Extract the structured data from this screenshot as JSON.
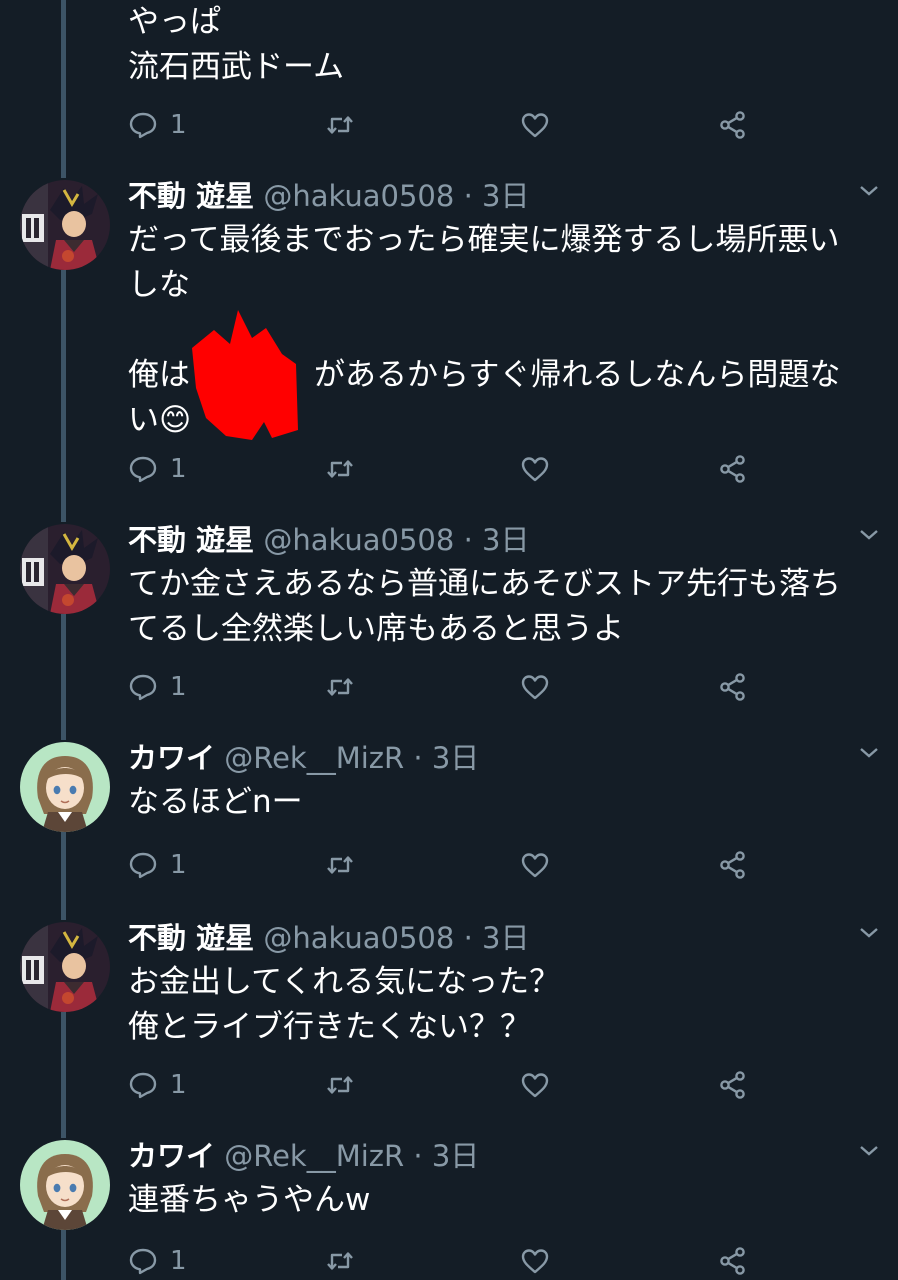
{
  "theme": {
    "background": "#141d26",
    "muted": "#8899a6",
    "thread_line": "#3d5466",
    "redaction": "#ff0000"
  },
  "tweets": [
    {
      "name": "",
      "handle": "",
      "sep": "",
      "time": "",
      "lines": [
        "やっぱ",
        "流石西武ドーム"
      ],
      "reply_count": "1",
      "icons": [
        "reply-icon",
        "retweet-icon",
        "like-icon",
        "share-icon"
      ]
    },
    {
      "name": "不動 遊星",
      "handle": "@hakua0508",
      "sep": "·",
      "time": "3日",
      "lines": [
        "だって最後までおったら確実に爆発するし場所悪い",
        "しな",
        "",
        "俺は　　　　があるからすぐ帰れるしなんら問題な",
        "い😊"
      ],
      "reply_count": "1",
      "avatar": "yusei-avatar"
    },
    {
      "name": "不動 遊星",
      "handle": "@hakua0508",
      "sep": "·",
      "time": "3日",
      "lines": [
        "てか金さえあるなら普通にあそびストア先行も落ち",
        "てるし全然楽しい席もあると思うよ"
      ],
      "reply_count": "1",
      "avatar": "yusei-avatar"
    },
    {
      "name": "カワイ",
      "handle": "@Rek__MizR",
      "sep": "·",
      "time": "3日",
      "lines": [
        "なるほどnー"
      ],
      "reply_count": "1",
      "avatar": "kawai-avatar"
    },
    {
      "name": "不動 遊星",
      "handle": "@hakua0508",
      "sep": "·",
      "time": "3日",
      "lines": [
        "お金出してくれる気になった？",
        "俺とライブ行きたくない？？"
      ],
      "reply_count": "1",
      "avatar": "yusei-avatar"
    },
    {
      "name": "カワイ",
      "handle": "@Rek__MizR",
      "sep": "·",
      "time": "3日",
      "lines": [
        "連番ちゃうやんw"
      ],
      "reply_count": "1",
      "avatar": "kawai-avatar"
    }
  ]
}
